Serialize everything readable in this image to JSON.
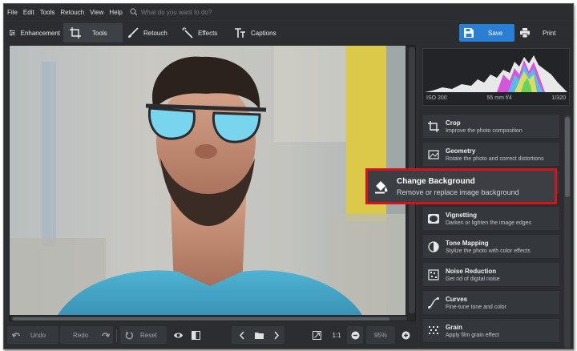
{
  "menu": [
    "File",
    "Edit",
    "Tools",
    "Retouch",
    "View",
    "Help"
  ],
  "search": {
    "placeholder": "What do you want to do?",
    "icon": "search-icon"
  },
  "tabs": [
    {
      "label": "Enhancement",
      "icon": "sliders-icon",
      "active": false
    },
    {
      "label": "Tools",
      "icon": "crop-icon",
      "active": true
    },
    {
      "label": "Retouch",
      "icon": "brush-icon",
      "active": false
    },
    {
      "label": "Effects",
      "icon": "magic-wand-icon",
      "active": false
    },
    {
      "label": "Captions",
      "icon": "text-icon",
      "active": false
    }
  ],
  "actions": {
    "save": "Save",
    "print": "Print"
  },
  "histogram": {
    "iso": "ISO 200",
    "lens": "55 mm f/4",
    "shutter": "1/320"
  },
  "tools": [
    {
      "name": "Crop",
      "desc": "Improve the photo composition",
      "icon": "crop-icon"
    },
    {
      "name": "Geometry",
      "desc": "Rotate the photo and correct distortions",
      "icon": "geometry-icon"
    },
    {
      "name": "Change Background",
      "desc": "Remove or replace image background",
      "icon": "paint-bucket-icon"
    },
    {
      "name": "Vignetting",
      "desc": "Darken or lighten the image edges",
      "icon": "vignette-icon"
    },
    {
      "name": "Tone Mapping",
      "desc": "Stylize the photo with color effects",
      "icon": "tone-icon"
    },
    {
      "name": "Noise Reduction",
      "desc": "Get rid of digital noise",
      "icon": "noise-icon"
    },
    {
      "name": "Curves",
      "desc": "Fine-tune tone and color",
      "icon": "curves-icon"
    },
    {
      "name": "Grain",
      "desc": "Apply film grain effect",
      "icon": "grain-icon"
    }
  ],
  "bottom": {
    "undo": "Undo",
    "redo": "Redo",
    "reset": "Reset",
    "ratio": "1:1",
    "zoom": "95%"
  },
  "colors": {
    "accent": "#2a7fd4",
    "highlight": "#d8121a"
  }
}
